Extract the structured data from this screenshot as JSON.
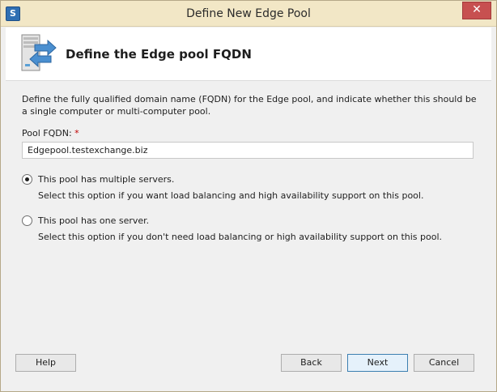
{
  "window": {
    "title": "Define New Edge Pool",
    "app_icon": "S",
    "close_glyph": "✕"
  },
  "header": {
    "title": "Define the Edge pool FQDN",
    "icon": "server-with-arrows-icon"
  },
  "description": "Define the fully qualified domain name (FQDN) for the Edge pool, and indicate whether this should be a single computer or multi-computer pool.",
  "fqdn": {
    "label": "Pool FQDN:",
    "required_mark": "*",
    "value": "Edgepool.testexchange.biz"
  },
  "options": [
    {
      "label": "This pool has multiple servers.",
      "description": "Select this option if you want load balancing and high availability support on this pool.",
      "selected": true
    },
    {
      "label": "This pool has one server.",
      "description": "Select this option if you don't need load balancing or high availability support on this pool.",
      "selected": false
    }
  ],
  "buttons": {
    "help": "Help",
    "back": "Back",
    "next": "Next",
    "cancel": "Cancel"
  },
  "colors": {
    "titlebar": "#f2e7c6",
    "close": "#c75050",
    "accent": "#3c7fb1"
  }
}
